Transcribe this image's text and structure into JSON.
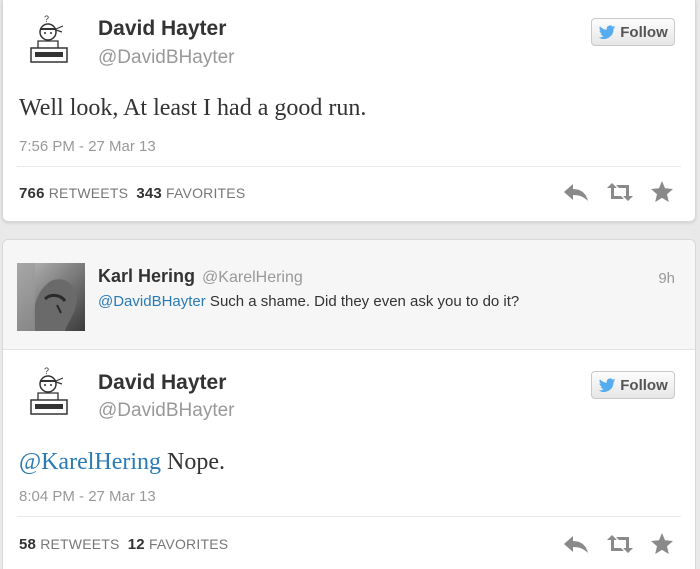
{
  "tweet1": {
    "name": "David Hayter",
    "handle": "@DavidBHayter",
    "follow_label": "Follow",
    "text": "Well look, At least I had a good run.",
    "timestamp": "7:56 PM - 27 Mar 13",
    "retweets_count": "766",
    "retweets_label": "RETWEETS",
    "favorites_count": "343",
    "favorites_label": "FAVORITES"
  },
  "reply": {
    "name": "Karl Hering",
    "handle": "@KarelHering",
    "time_ago": "9h",
    "mention": "@DavidBHayter",
    "text": " Such a shame. Did they even ask you to do it?"
  },
  "tweet2": {
    "name": "David Hayter",
    "handle": "@DavidBHayter",
    "follow_label": "Follow",
    "mention": "@KarelHering",
    "text": " Nope.",
    "timestamp": "8:04 PM - 27 Mar 13",
    "retweets_count": "58",
    "retweets_label": "RETWEETS",
    "favorites_count": "12",
    "favorites_label": "FAVORITES"
  },
  "icons": {
    "avatar_david": "snake-box-avatar-icon",
    "avatar_karl": "grayscale-face-avatar-icon",
    "follow": "twitter-bird-icon",
    "reply": "reply-arrow-icon",
    "retweet": "retweet-icon",
    "favorite": "star-icon"
  },
  "colors": {
    "mention": "#2a7bb5",
    "secondary_text": "#999999",
    "action_icon": "#8a8a8a"
  }
}
